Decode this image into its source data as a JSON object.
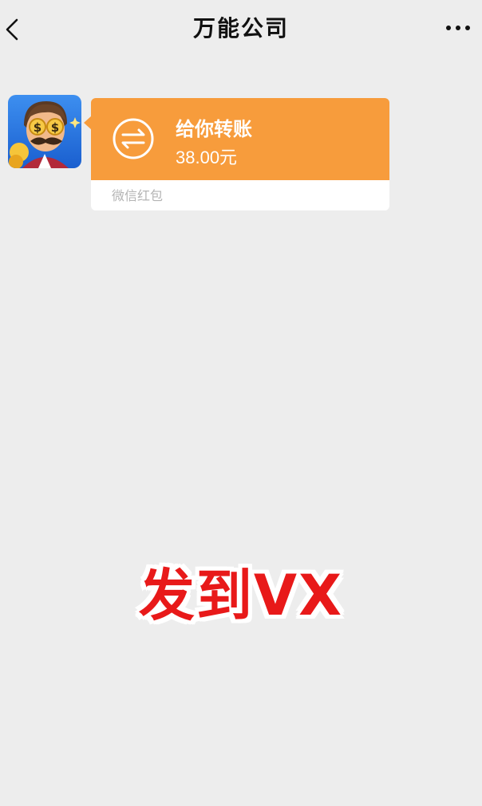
{
  "header": {
    "title": "万能公司",
    "back_icon": "chevron-left-icon",
    "more_icon": "more-horizontal-icon"
  },
  "message": {
    "avatar_icon": "cartoon-rich-man-avatar",
    "transfer": {
      "icon": "transfer-arrows-icon",
      "title": "给你转账",
      "amount": "38.00元",
      "source": "微信红包",
      "accent_color": "#f79c3c"
    }
  },
  "overlay": {
    "caption": "发到VX",
    "color": "#e81919"
  }
}
